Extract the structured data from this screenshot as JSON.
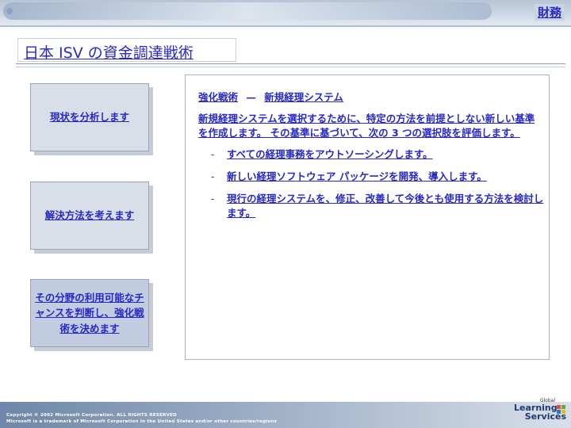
{
  "header": {
    "corner_link": "財務"
  },
  "title": "日本 ISV の資金調達戦術",
  "steps": [
    {
      "label": "現状を分析します"
    },
    {
      "label": "解決方法を考えます"
    },
    {
      "label": "その分野の利用可能なチャンスを判断し、強化戦術を決めます"
    }
  ],
  "panel": {
    "heading_left": "強化戦術",
    "heading_sep": "—",
    "heading_right": "新規経理システム",
    "body": "新規経理システムを選択するために、特定の方法を前提としない新しい基準を作成します。 その基準に基づいて、次の 3 つの選択肢を評価します。",
    "bullets": [
      {
        "mark": "-",
        "text": "すべての経理事務をアウトソーシングします。"
      },
      {
        "mark": "-",
        "text": "新しい経理ソフトウェア パッケージを開発、導入します。"
      },
      {
        "mark": "-",
        "text": "現行の経理システムを、修正、改善して今後とも使用する方法を検討します。"
      }
    ]
  },
  "footer": {
    "copyright_line1": "Copyright © 2002 Microsoft Corporation. ALL RIGHTS RESERVED",
    "copyright_line2": "Microsoft is a trademark of Microsoft Corporation in the United States and/or other countries/regions",
    "logo_small": "Global",
    "logo_word1": "Learning",
    "logo_word2": "Services"
  },
  "colors": {
    "link": "#2828c8",
    "band": "#b7c4d6"
  }
}
